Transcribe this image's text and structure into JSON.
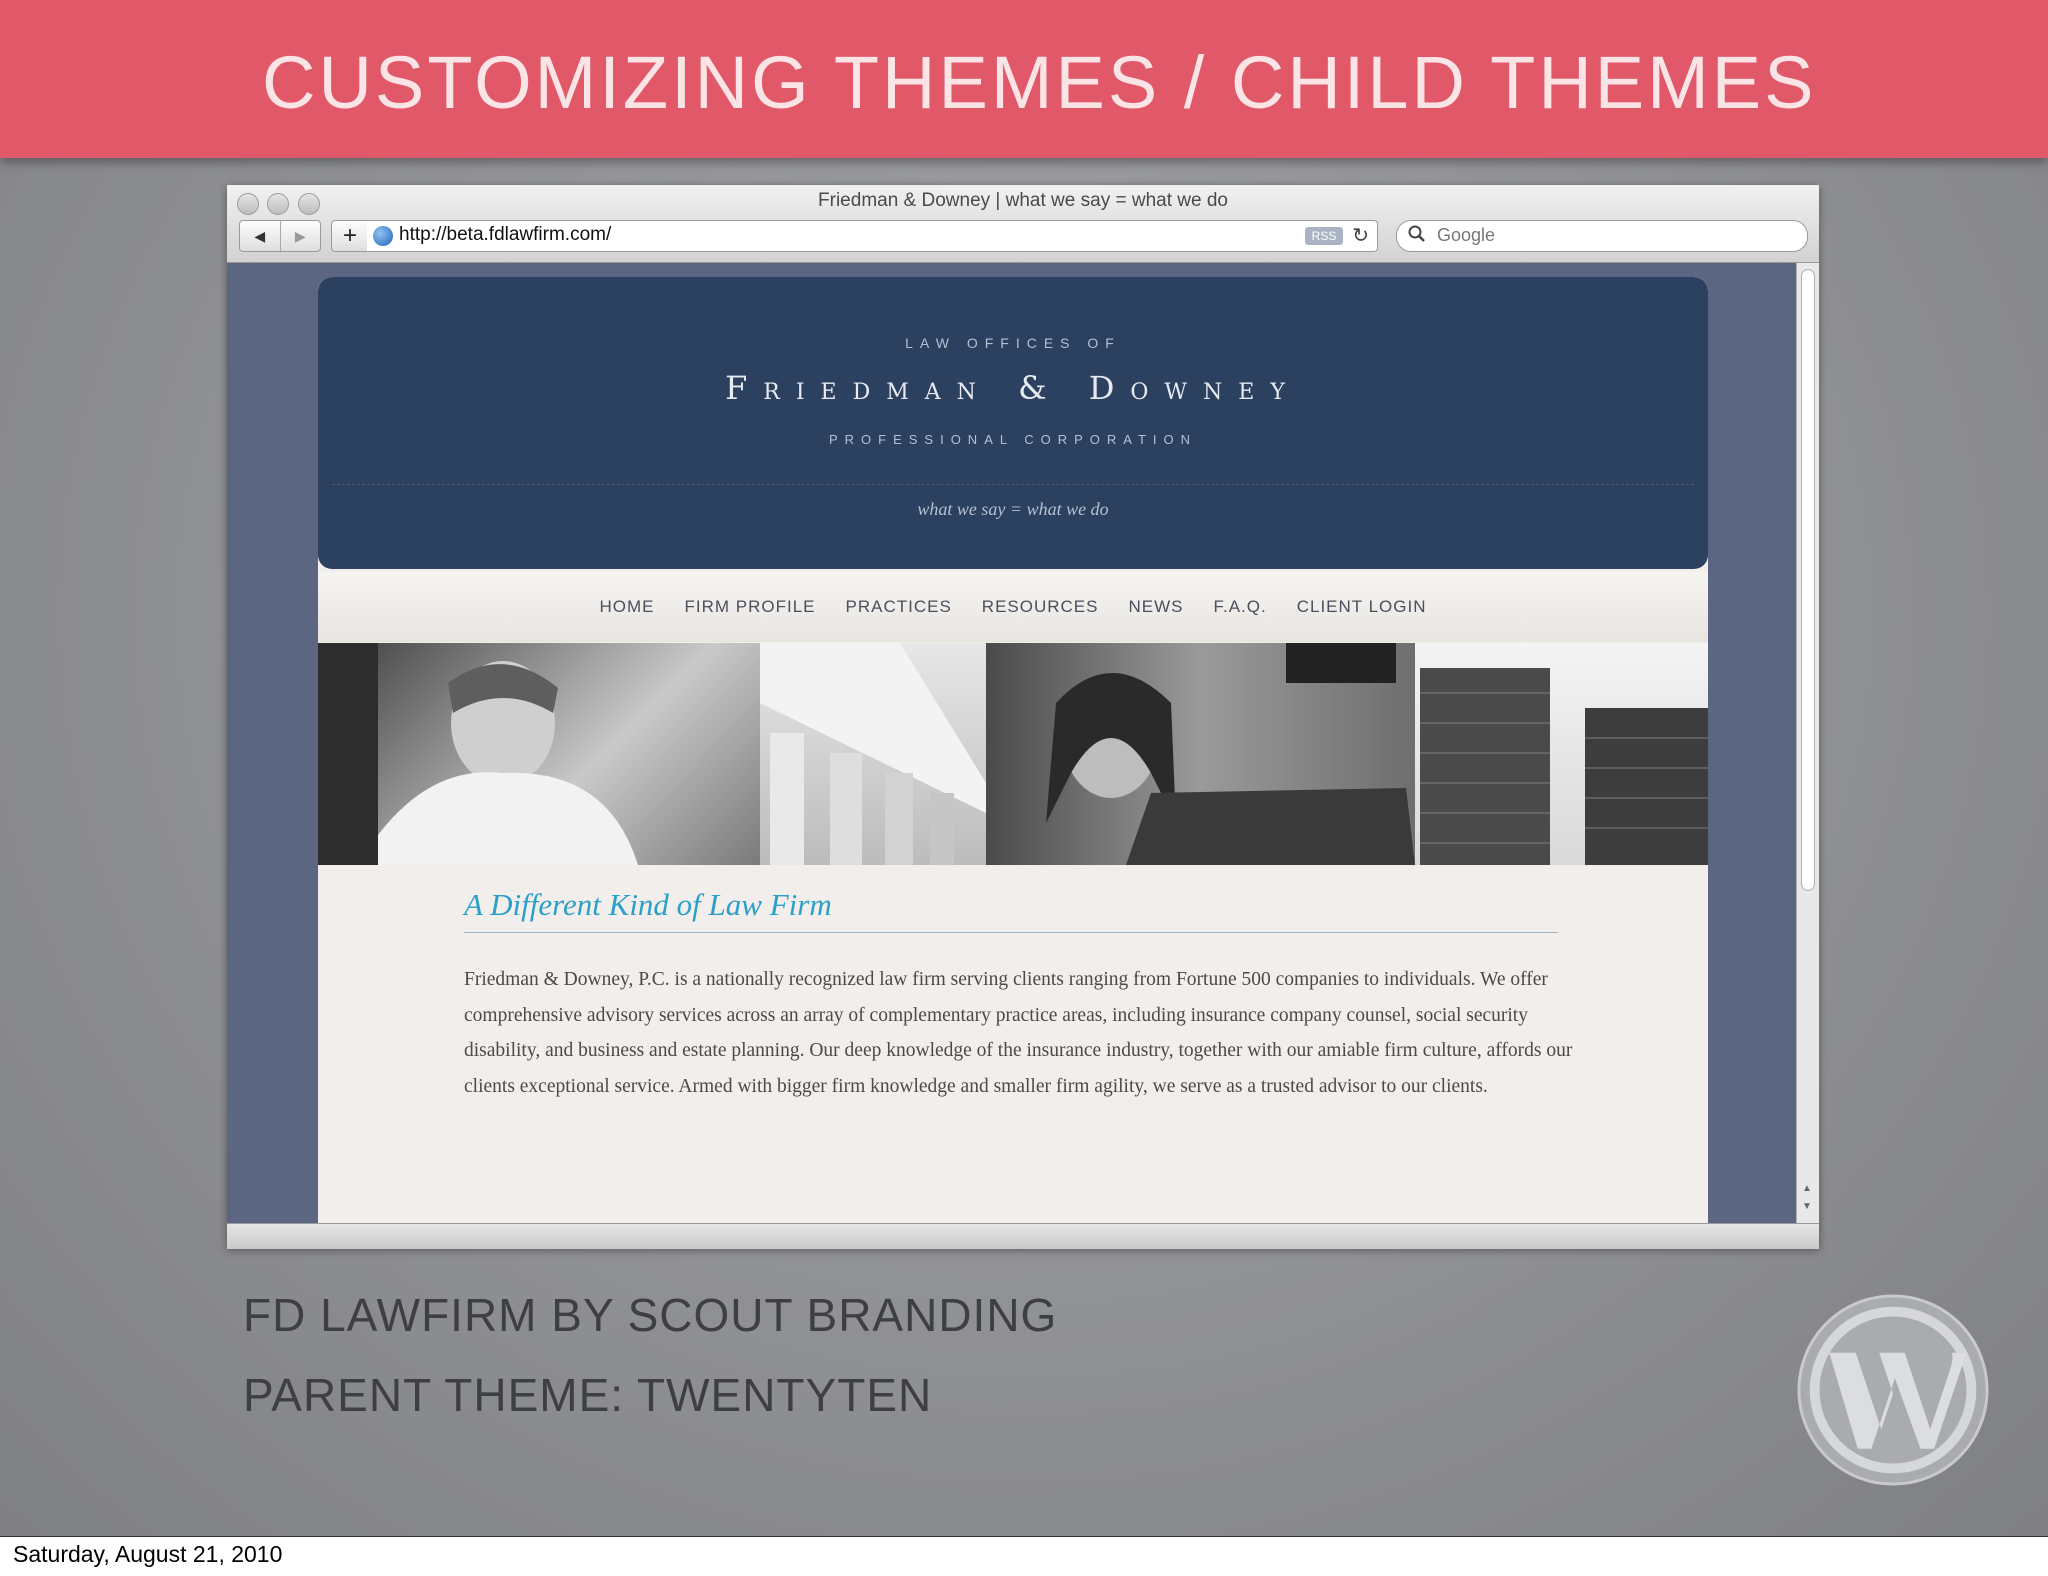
{
  "slide": {
    "title": "CUSTOMIZING THEMES / CHILD THEMES",
    "caption_line1": "FD LAWFIRM BY SCOUT BRANDING",
    "caption_line2": "PARENT THEME: TWENTYTEN",
    "footer_date": "Saturday, August 21, 2010",
    "logo_icon": "wordpress-logo-icon",
    "colors": {
      "header": "#e15868",
      "masthead": "#2c4060",
      "title_accent": "#2aa0c9"
    }
  },
  "browser": {
    "window_title": "Friedman & Downey | what we say = what we do",
    "back_icon": "◀",
    "forward_icon": "▶",
    "add_icon": "+",
    "url": "http://beta.fdlawfirm.com/",
    "rss_label": "RSS",
    "reload_icon": "↻",
    "search_icon": "🔍",
    "search_placeholder": "Google"
  },
  "site": {
    "law_offices": "LAW OFFICES OF",
    "firm_name": "Friedman & Downey",
    "professional_corp": "PROFESSIONAL CORPORATION",
    "tagline": "what we say = what we do",
    "nav": [
      "HOME",
      "FIRM PROFILE",
      "PRACTICES",
      "RESOURCES",
      "NEWS",
      "F.A.Q.",
      "CLIENT LOGIN"
    ],
    "content_title": "A Different Kind of Law Firm",
    "content_body": "Friedman & Downey, P.C. is a nationally recognized law firm serving clients ranging from Fortune 500 companies to individuals. We offer comprehensive advisory services across an array of complementary practice areas, including insurance company counsel, social security disability, and business and estate planning. Our deep knowledge of the insurance industry, together with our amiable firm culture, affords our clients exceptional service. Armed with bigger firm knowledge and smaller firm agility, we serve as a trusted advisor to our clients."
  }
}
